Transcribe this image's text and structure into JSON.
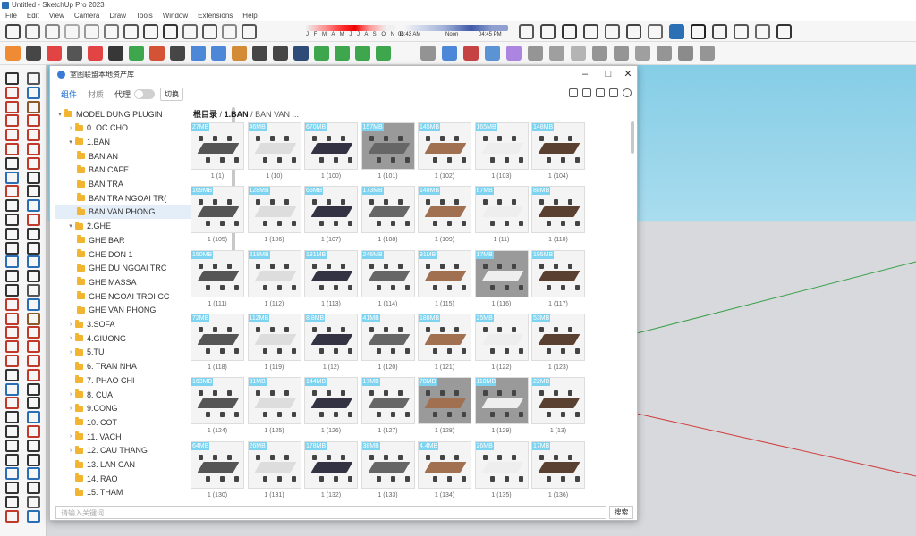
{
  "app": {
    "title": "Untitled - SketchUp Pro 2023"
  },
  "menu": [
    "File",
    "Edit",
    "View",
    "Camera",
    "Draw",
    "Tools",
    "Window",
    "Extensions",
    "Help"
  ],
  "shadow": {
    "months": "J F M A M J J A S O N D",
    "time_start": "06:43 AM",
    "time_mid": "Noon",
    "time_end": "04:45 PM"
  },
  "dialog": {
    "title": "室图联盟本地资产库",
    "tabs": [
      "组件",
      "材质",
      "代理"
    ],
    "switch_label": "切换",
    "breadcrumb_root": "根目录",
    "breadcrumb_sep": "/",
    "breadcrumb_current": "1.BAN",
    "breadcrumb_rest": "/ BAN VAN ...",
    "search_placeholder": "请输入关键词...",
    "search_button": "搜索"
  },
  "tree": [
    {
      "label": "MODEL DUNG PLUGIN",
      "level": 0,
      "arrow": "▾"
    },
    {
      "label": "0. OC CHO",
      "level": 1,
      "arrow": "›"
    },
    {
      "label": "1.BAN",
      "level": 1,
      "arrow": "▾"
    },
    {
      "label": "BAN AN",
      "level": 2,
      "arrow": ""
    },
    {
      "label": "BAN CAFE",
      "level": 2,
      "arrow": ""
    },
    {
      "label": "BAN TRA",
      "level": 2,
      "arrow": ""
    },
    {
      "label": "BAN TRA NGOAI TR(",
      "level": 2,
      "arrow": ""
    },
    {
      "label": "BAN VAN PHONG",
      "level": 2,
      "arrow": "",
      "selected": true
    },
    {
      "label": "2.GHE",
      "level": 1,
      "arrow": "▾"
    },
    {
      "label": "GHE BAR",
      "level": 2,
      "arrow": ""
    },
    {
      "label": "GHE DON 1",
      "level": 2,
      "arrow": ""
    },
    {
      "label": "GHE DU NGOAI TRC",
      "level": 2,
      "arrow": ""
    },
    {
      "label": "GHE MASSA",
      "level": 2,
      "arrow": ""
    },
    {
      "label": "GHE NGOAI TROI CC",
      "level": 2,
      "arrow": ""
    },
    {
      "label": "GHE VAN PHONG",
      "level": 2,
      "arrow": ""
    },
    {
      "label": "3.SOFA",
      "level": 1,
      "arrow": "›"
    },
    {
      "label": "4.GIUONG",
      "level": 1,
      "arrow": "›"
    },
    {
      "label": "5.TU",
      "level": 1,
      "arrow": "›"
    },
    {
      "label": "6. TRAN NHA",
      "level": 1,
      "arrow": ""
    },
    {
      "label": "7. PHAO CHI",
      "level": 1,
      "arrow": ""
    },
    {
      "label": "8. CUA",
      "level": 1,
      "arrow": "›"
    },
    {
      "label": "9.CONG",
      "level": 1,
      "arrow": "›"
    },
    {
      "label": "10. COT",
      "level": 1,
      "arrow": ""
    },
    {
      "label": "11. VACH",
      "level": 1,
      "arrow": "›"
    },
    {
      "label": "12. CAU THANG",
      "level": 1,
      "arrow": "›"
    },
    {
      "label": "13. LAN CAN",
      "level": 1,
      "arrow": ""
    },
    {
      "label": "14. RAO",
      "level": 1,
      "arrow": ""
    },
    {
      "label": "15. THAM",
      "level": 1,
      "arrow": ""
    }
  ],
  "items": [
    {
      "size": "27MB",
      "label": "1 (1)"
    },
    {
      "size": "46MB",
      "label": "1 (10)"
    },
    {
      "size": "670MB",
      "label": "1 (100)"
    },
    {
      "size": "157MB",
      "label": "1 (101)",
      "dark": true
    },
    {
      "size": "145MB",
      "label": "1 (102)"
    },
    {
      "size": "165MB",
      "label": "1 (103)"
    },
    {
      "size": "148MB",
      "label": "1 (104)"
    },
    {
      "size": "169MB",
      "label": "1 (105)"
    },
    {
      "size": "128MB",
      "label": "1 (106)"
    },
    {
      "size": "65MB",
      "label": "1 (107)"
    },
    {
      "size": "173MB",
      "label": "1 (108)"
    },
    {
      "size": "148MB",
      "label": "1 (109)"
    },
    {
      "size": "67MB",
      "label": "1 (11)"
    },
    {
      "size": "88MB",
      "label": "1 (110)"
    },
    {
      "size": "150MB",
      "label": "1 (111)"
    },
    {
      "size": "218MB",
      "label": "1 (112)"
    },
    {
      "size": "181MB",
      "label": "1 (113)"
    },
    {
      "size": "246MB",
      "label": "1 (114)"
    },
    {
      "size": "91MB",
      "label": "1 (115)"
    },
    {
      "size": "17MB",
      "label": "1 (116)",
      "dark": true
    },
    {
      "size": "195MB",
      "label": "1 (117)"
    },
    {
      "size": "72MB",
      "label": "1 (118)"
    },
    {
      "size": "112MB",
      "label": "1 (119)"
    },
    {
      "size": "8.8MB",
      "label": "1 (12)"
    },
    {
      "size": "41MB",
      "label": "1 (120)"
    },
    {
      "size": "188MB",
      "label": "1 (121)"
    },
    {
      "size": "25MB",
      "label": "1 (122)"
    },
    {
      "size": "53MB",
      "label": "1 (123)"
    },
    {
      "size": "163MB",
      "label": "1 (124)"
    },
    {
      "size": "31MB",
      "label": "1 (125)"
    },
    {
      "size": "144MB",
      "label": "1 (126)"
    },
    {
      "size": "17MB",
      "label": "1 (127)"
    },
    {
      "size": "78MB",
      "label": "1 (128)",
      "dark": true
    },
    {
      "size": "110MB",
      "label": "1 (129)",
      "dark": true
    },
    {
      "size": "22MB",
      "label": "1 (13)"
    },
    {
      "size": "64MB",
      "label": "1 (130)"
    },
    {
      "size": "26MB",
      "label": "1 (131)"
    },
    {
      "size": "178MB",
      "label": "1 (132)"
    },
    {
      "size": "38MB",
      "label": "1 (133)"
    },
    {
      "size": "4.4MB",
      "label": "1 (134)"
    },
    {
      "size": "26MB",
      "label": "1 (135)"
    },
    {
      "size": "17MB",
      "label": "1 (136)"
    }
  ]
}
